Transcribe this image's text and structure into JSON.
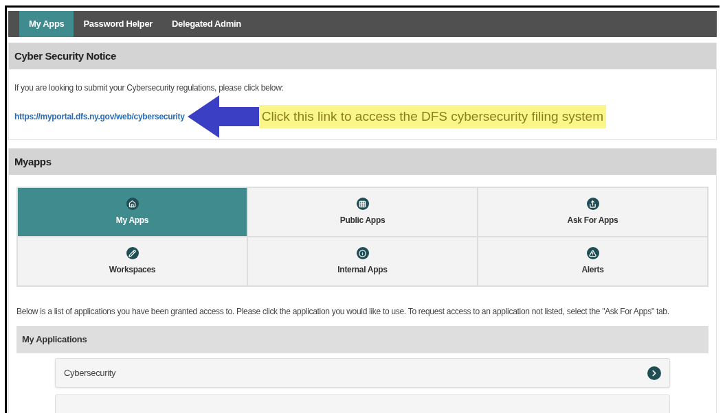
{
  "nav": {
    "tabs": [
      {
        "label": "My Apps",
        "selected": true
      },
      {
        "label": "Password Helper",
        "selected": false
      },
      {
        "label": "Delegated Admin",
        "selected": false
      }
    ]
  },
  "notice": {
    "title": "Cyber Security Notice",
    "text": "If you are looking to submit your Cybersecurity regulations, please click below:",
    "link": "https://myportal.dfs.ny.gov/web/cybersecurity",
    "callout": "Click this link to access the DFS cybersecurity filing system"
  },
  "myapps": {
    "title": "Myapps",
    "tiles": [
      {
        "label": "My Apps",
        "selected": true
      },
      {
        "label": "Public Apps",
        "selected": false
      },
      {
        "label": "Ask For Apps",
        "selected": false
      },
      {
        "label": "Workspaces",
        "selected": false
      },
      {
        "label": "Internal Apps",
        "selected": false
      },
      {
        "label": "Alerts",
        "selected": false
      }
    ],
    "intro": "Below is a list of applications you have been granted access to. Please click the application you would like to use. To request access to an application not listed, select the \"Ask For Apps\" tab.",
    "list_title": "My Applications",
    "applications": [
      {
        "label": "Cybersecurity"
      }
    ]
  }
}
